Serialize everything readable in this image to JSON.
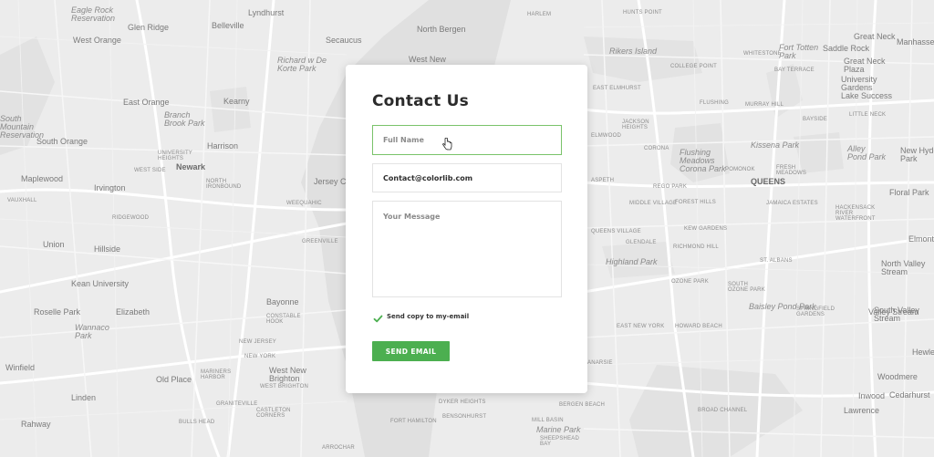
{
  "map": {
    "labels": [
      {
        "text": "Eagle Rock\nReservation",
        "style": "it"
      },
      {
        "text": "Lyndhurst",
        "style": "big"
      },
      {
        "text": "Glen Ridge",
        "style": "big"
      },
      {
        "text": "North Bergen",
        "style": "big"
      },
      {
        "text": "HARLEM",
        "style": "sm"
      },
      {
        "text": "HUNTS POINT",
        "style": "sm"
      },
      {
        "text": "Great Neck",
        "style": "big"
      },
      {
        "text": "Manhasset",
        "style": "big"
      },
      {
        "text": "West Orange",
        "style": "big"
      },
      {
        "text": "Belleville",
        "style": "big"
      },
      {
        "text": "Richard w De\nKorte Park",
        "style": "it"
      },
      {
        "text": "Secaucus",
        "style": "big"
      },
      {
        "text": "West New",
        "style": "big"
      },
      {
        "text": "Rikers Island",
        "style": "it"
      },
      {
        "text": "WHITESTONE",
        "style": "sm"
      },
      {
        "text": "Fort Totten\nPark",
        "style": "it"
      },
      {
        "text": "Saddle Rock",
        "style": "big"
      },
      {
        "text": "Great Neck\nPlaza",
        "style": "big"
      },
      {
        "text": "COLLEGE POINT",
        "style": "sm"
      },
      {
        "text": "BAY TERRACE",
        "style": "sm"
      },
      {
        "text": "University\nGardens",
        "style": "big"
      },
      {
        "text": "East Orange",
        "style": "big"
      },
      {
        "text": "Kearny",
        "style": "big"
      },
      {
        "text": "EAST ELMHURST",
        "style": "sm"
      },
      {
        "text": "FLUSHING",
        "style": "sm"
      },
      {
        "text": "MURRAY HILL",
        "style": "sm"
      },
      {
        "text": "Lake Success",
        "style": "big"
      },
      {
        "text": "Branch\nBrook Park",
        "style": "it"
      },
      {
        "text": "JACKSON\nHEIGHTS",
        "style": "sm"
      },
      {
        "text": "BAYSIDE",
        "style": "sm"
      },
      {
        "text": "LITTLE NECK",
        "style": "sm"
      },
      {
        "text": "South\nMountain\nReservation",
        "style": "it"
      },
      {
        "text": "South Orange",
        "style": "big"
      },
      {
        "text": "Harrison",
        "style": "big"
      },
      {
        "text": "ELMWOOD",
        "style": "sm"
      },
      {
        "text": "Kissena Park",
        "style": "it"
      },
      {
        "text": "Alley\nPond Park",
        "style": "it"
      },
      {
        "text": "UNIVERSITY\nHEIGHTS",
        "style": "sm"
      },
      {
        "text": "CORONA",
        "style": "sm"
      },
      {
        "text": "Flushing\nMeadows\nCorona Park",
        "style": "it"
      },
      {
        "text": "Newark",
        "style": "bold"
      },
      {
        "text": "WEST SIDE",
        "style": "sm"
      },
      {
        "text": "POMONOK",
        "style": "sm"
      },
      {
        "text": "FRESH\nMEADOWS",
        "style": "sm"
      },
      {
        "text": "New Hyde\nPark",
        "style": "big"
      },
      {
        "text": "Maplewood",
        "style": "big"
      },
      {
        "text": "NORTH\nIRONBOUND",
        "style": "sm"
      },
      {
        "text": "Jersey C",
        "style": "big"
      },
      {
        "text": "ASPETH",
        "style": "sm"
      },
      {
        "text": "REGO PARK",
        "style": "sm"
      },
      {
        "text": "QUEENS",
        "style": "bold"
      },
      {
        "text": "Irvington",
        "style": "big"
      },
      {
        "text": "Floral Park",
        "style": "big"
      },
      {
        "text": "VAUXHALL",
        "style": "sm"
      },
      {
        "text": "MIDDLE VILLAGE",
        "style": "sm"
      },
      {
        "text": "FOREST HILLS",
        "style": "sm"
      },
      {
        "text": "JAMAICA ESTATES",
        "style": "sm"
      },
      {
        "text": "HACKENSACK\nRIVER\nWATERFRONT",
        "style": "sm"
      },
      {
        "text": "WEEQUAHIC",
        "style": "sm"
      },
      {
        "text": "RIDGEWOOD",
        "style": "sm"
      },
      {
        "text": "QUEENS VILLAGE",
        "style": "sm"
      },
      {
        "text": "KEW GARDENS",
        "style": "sm"
      },
      {
        "text": "GREENVILLE",
        "style": "sm"
      },
      {
        "text": "Union",
        "style": "big"
      },
      {
        "text": "Hillside",
        "style": "big"
      },
      {
        "text": "GLENDALE",
        "style": "sm"
      },
      {
        "text": "RICHMOND HILL",
        "style": "sm"
      },
      {
        "text": "Elmont",
        "style": "big"
      },
      {
        "text": "Highland Park",
        "style": "it"
      },
      {
        "text": "ST. ALBANS",
        "style": "sm"
      },
      {
        "text": "Kean University",
        "style": "big"
      },
      {
        "text": "OZONE PARK",
        "style": "sm"
      },
      {
        "text": "North Valley\nStream",
        "style": "big"
      },
      {
        "text": "SOUTH\nOZONE PARK",
        "style": "sm"
      },
      {
        "text": "Bayonne",
        "style": "big"
      },
      {
        "text": "Roselle Park",
        "style": "big"
      },
      {
        "text": "Elizabeth",
        "style": "big"
      },
      {
        "text": "CONSTABLE\nHOOK",
        "style": "sm"
      },
      {
        "text": "Baisley Pond Park",
        "style": "it"
      },
      {
        "text": "Springfield\nGardens",
        "style": "sm"
      },
      {
        "text": "Valley Stream",
        "style": "big"
      },
      {
        "text": "Wannaco\nPark",
        "style": "it"
      },
      {
        "text": "EAST NEW YORK",
        "style": "sm"
      },
      {
        "text": "HOWARD BEACH",
        "style": "sm"
      },
      {
        "text": "South Valley\nStream",
        "style": "big"
      },
      {
        "text": "NEW JERSEY",
        "style": "sm"
      },
      {
        "text": "NEW YORK",
        "style": "sm"
      },
      {
        "text": "Hewlett",
        "style": "big"
      },
      {
        "text": "Winfield",
        "style": "big"
      },
      {
        "text": "Old Place",
        "style": "big"
      },
      {
        "text": "MARINERS\nHARBOR",
        "style": "sm"
      },
      {
        "text": "West New\nBrighton",
        "style": "big"
      },
      {
        "text": "ANARSIE",
        "style": "sm"
      },
      {
        "text": "Woodmere",
        "style": "big"
      },
      {
        "text": "Linden",
        "style": "big"
      },
      {
        "text": "GRANITEVILLE",
        "style": "sm"
      },
      {
        "text": "WEST BRIGHTON",
        "style": "sm"
      },
      {
        "text": "Inwood",
        "style": "big"
      },
      {
        "text": "Cedarhurst",
        "style": "big"
      },
      {
        "text": "CASTLETON\nCORNERS",
        "style": "sm"
      },
      {
        "text": "BULLS HEAD",
        "style": "sm"
      },
      {
        "text": "DYKER HEIGHTS",
        "style": "sm"
      },
      {
        "text": "BERGEN BEACH",
        "style": "sm"
      },
      {
        "text": "BROAD CHANNEL",
        "style": "sm"
      },
      {
        "text": "Lawrence",
        "style": "big"
      },
      {
        "text": "Rahway",
        "style": "big"
      },
      {
        "text": "FORT HAMILTON",
        "style": "sm"
      },
      {
        "text": "BENSONHURST",
        "style": "sm"
      },
      {
        "text": "MILL BASIN",
        "style": "sm"
      },
      {
        "text": "Marine Park",
        "style": "it"
      },
      {
        "text": "SHEEPSHEAD\nBAY",
        "style": "sm"
      },
      {
        "text": "ARROCHAR",
        "style": "sm"
      }
    ]
  },
  "contact": {
    "title": "Contact Us",
    "name_placeholder": "Full Name",
    "email_value": "Contact@colorlib.com",
    "message_placeholder": "Your Message",
    "copy_label": "Send copy to my-email",
    "copy_checked": true,
    "submit_label": "SEND EMAIL",
    "accent_color": "#4caf50",
    "focus_border_color": "#7ac36a"
  }
}
